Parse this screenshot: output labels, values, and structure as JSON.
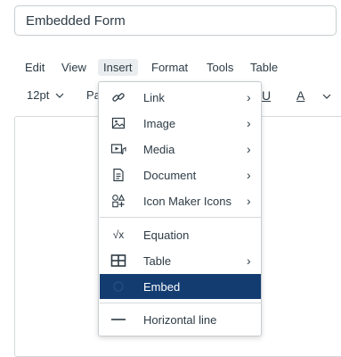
{
  "form": {
    "title_value": "Embedded Form"
  },
  "menubar": {
    "items": [
      {
        "label": "Edit"
      },
      {
        "label": "View"
      },
      {
        "label": "Insert"
      },
      {
        "label": "Format"
      },
      {
        "label": "Tools"
      },
      {
        "label": "Table"
      }
    ]
  },
  "toolbar": {
    "font_size": "12pt",
    "paragraph_partial": "Pa",
    "underline_glyph": "U",
    "text_color_glyph": "A"
  },
  "insert_menu": {
    "items": [
      {
        "label": "Link",
        "icon": "link-icon",
        "submenu": true
      },
      {
        "label": "Image",
        "icon": "image-icon",
        "submenu": true
      },
      {
        "label": "Media",
        "icon": "media-icon",
        "submenu": true
      },
      {
        "label": "Document",
        "icon": "document-icon",
        "submenu": true
      },
      {
        "label": "Icon Maker Icons",
        "icon": "icon-maker-icon",
        "submenu": true
      },
      {
        "label": "Equation",
        "icon": "equation-icon",
        "submenu": false
      },
      {
        "label": "Table",
        "icon": "table-icon",
        "submenu": true
      },
      {
        "label": "Embed",
        "icon": "embed-icon",
        "submenu": false,
        "selected": true
      },
      {
        "label": "Horizontal line",
        "icon": "horizontal-line-icon",
        "submenu": false
      }
    ],
    "selected_color": "#133c71"
  }
}
